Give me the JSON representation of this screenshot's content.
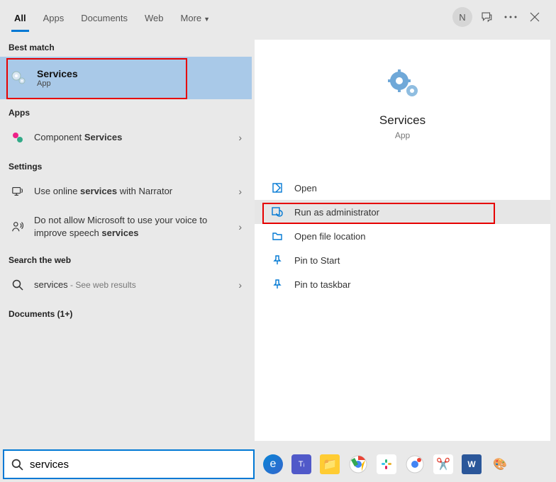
{
  "tabs": [
    "All",
    "Apps",
    "Documents",
    "Web",
    "More"
  ],
  "user_initial": "N",
  "left": {
    "best_match_header": "Best match",
    "best_match": {
      "title": "Services",
      "subtitle": "App"
    },
    "apps_header": "Apps",
    "apps_item_html": "Component <b>Services</b>",
    "settings_header": "Settings",
    "setting1_html": "Use online <b>services</b> with Narrator",
    "setting2_html": "Do not allow Microsoft to use your voice to improve speech <b>services</b>",
    "web_header": "Search the web",
    "web_item_prefix": "services",
    "web_item_suffix": " - See web results",
    "docs_header": "Documents (1+)"
  },
  "right": {
    "title": "Services",
    "subtitle": "App",
    "actions": [
      "Open",
      "Run as administrator",
      "Open file location",
      "Pin to Start",
      "Pin to taskbar"
    ]
  },
  "search_value": "services"
}
